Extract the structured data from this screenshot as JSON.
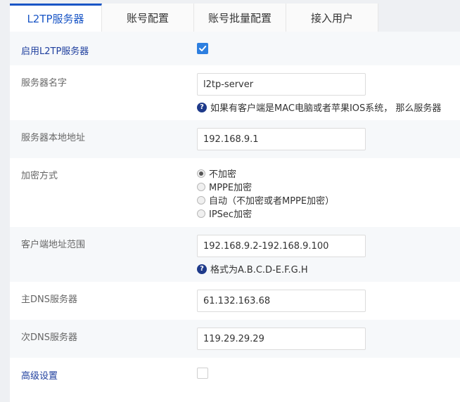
{
  "tabs": [
    {
      "label": "L2TP服务器",
      "active": true
    },
    {
      "label": "账号配置",
      "active": false
    },
    {
      "label": "账号批量配置",
      "active": false
    },
    {
      "label": "接入用户",
      "active": false
    }
  ],
  "form": {
    "enable": {
      "label": "启用L2TP服务器",
      "checked": true
    },
    "server_name": {
      "label": "服务器名字",
      "value": "l2tp-server",
      "hint": "如果有客户端是MAC电脑或者苹果IOS系统， 那么服务器"
    },
    "local_address": {
      "label": "服务器本地地址",
      "value": "192.168.9.1"
    },
    "encryption": {
      "label": "加密方式",
      "options": [
        "不加密",
        "MPPE加密",
        "自动（不加密或者MPPE加密）",
        "IPSec加密"
      ],
      "selected_index": 0
    },
    "client_range": {
      "label": "客户端地址范围",
      "value": "192.168.9.2-192.168.9.100",
      "hint": "格式为A.B.C.D-E.F.G.H"
    },
    "primary_dns": {
      "label": "主DNS服务器",
      "value": "61.132.163.68"
    },
    "secondary_dns": {
      "label": "次DNS服务器",
      "value": "119.29.29.29"
    },
    "advanced": {
      "label": "高级设置",
      "checked": false
    }
  },
  "colors": {
    "accent": "#1a56c6",
    "checkbox": "#2d7fe0",
    "hint_icon": "#1e3a8a"
  }
}
